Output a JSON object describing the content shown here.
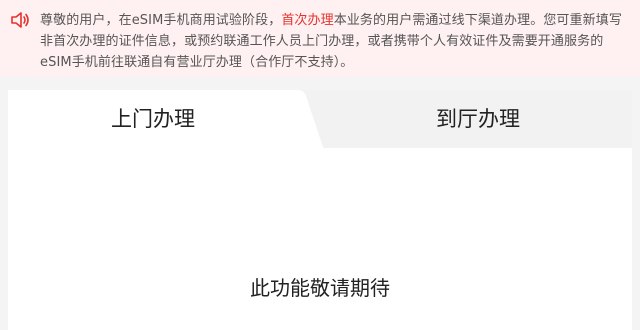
{
  "notice": {
    "icon": "speaker-icon",
    "text_before": "尊敬的用户，在eSIM手机商用试验阶段，",
    "highlight": "首次办理",
    "text_after": "本业务的用户需通过线下渠道办理。您可重新填写非首次办理的证件信息，或预约联通工作人员上门办理，或者携带个人有效证件及需要开通服务的eSIM手机前往联通自有营业厅办理（合作厅不支持）。",
    "highlight_color": "#e5322d"
  },
  "tabs": [
    {
      "label": "上门办理",
      "active": true
    },
    {
      "label": "到厅办理",
      "active": false
    }
  ],
  "content": {
    "message": "此功能敬请期待"
  }
}
